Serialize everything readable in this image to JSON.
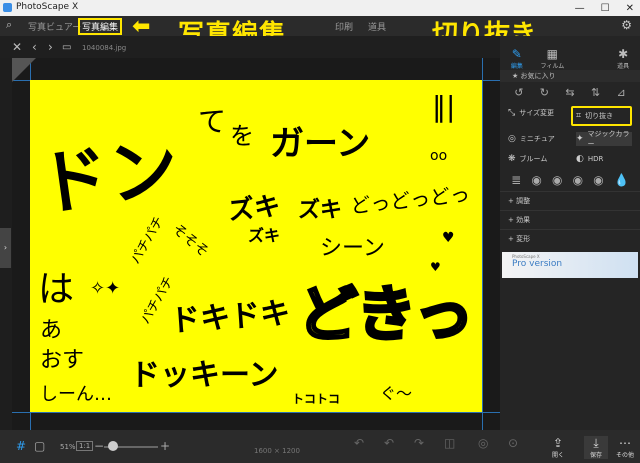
{
  "window": {
    "title": "PhotoScape X",
    "min": "—",
    "max": "☐",
    "close": "✕"
  },
  "menu": {
    "items": [
      "写真ビュアー",
      "写真編集",
      "印刷",
      "道具"
    ],
    "settings_icon": "gear-icon"
  },
  "toolbar2": {
    "filename": "1040084.jpg"
  },
  "photo_text": {
    "don": "ドン",
    "te": "て",
    "wo": "を",
    "gaan": "ガーン",
    "zuki1": "ズキ",
    "zuki2": "ズキ",
    "zuki3": "ズキ",
    "docchi": "どっどっどっ",
    "shiin": "シーン",
    "pachi1": "パチパチ",
    "pachi2": "パチパチ",
    "sorosoro": "そそそ",
    "ha": "は",
    "aa": "あ",
    "mu": "おす",
    "shiin2": "しーん…",
    "dokidoki": "ドキドキ",
    "dokiii": "ドッキーン",
    "toko": "トコトコ",
    "dokin": "どきっ",
    "guu": "ぐ〜",
    "oo": "oo"
  },
  "right_tools": [
    {
      "label": "編集",
      "icon": "pencil-icon"
    },
    {
      "label": "フィルム",
      "icon": "film-icon"
    },
    {
      "label": "",
      "icon": ""
    },
    {
      "label": "",
      "icon": ""
    },
    {
      "label": "道具",
      "icon": "tools-icon"
    }
  ],
  "right_panel": {
    "favorites": "お気に入り",
    "resize": "サイズ変更",
    "crop": "切り抜き",
    "miniature": "ミニチュア",
    "magic_color": "マジックカラー",
    "bloom": "ブルーム",
    "hdr": "HDR",
    "adjust": "調整",
    "effect": "効果",
    "transform": "変形",
    "promo_small": "PhotoScape X",
    "promo": "Pro version"
  },
  "bottom": {
    "zoom": "51%",
    "ratio": "1:1",
    "size": "1600 × 1200",
    "open": "開く",
    "save": "保存",
    "more": "その他"
  },
  "annotations": {
    "edit": "写真編集",
    "crop": "切り抜き"
  },
  "colors": {
    "highlight": "#ffe600",
    "accent": "#2f9ef0",
    "photo_bg": "#ffff00"
  }
}
